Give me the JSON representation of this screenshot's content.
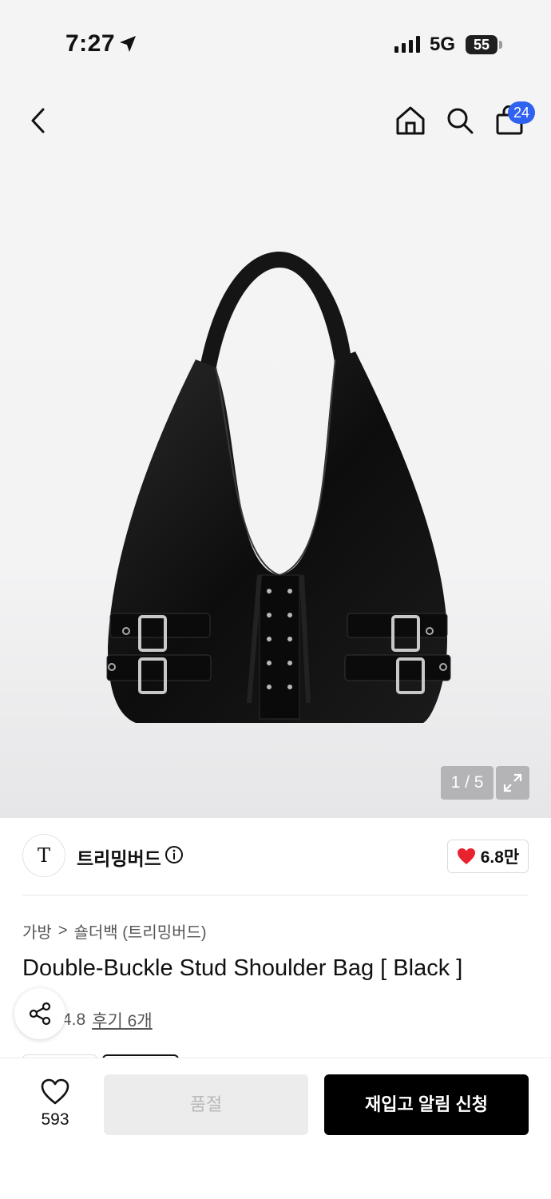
{
  "status_bar": {
    "time": "7:27",
    "network": "5G",
    "battery": "55",
    "location_icon": "location-arrow-icon",
    "signal_icon": "signal-bars-icon"
  },
  "nav": {
    "back_icon": "chevron-left-icon",
    "home_icon": "home-icon",
    "search_icon": "search-icon",
    "cart_icon": "shopping-bag-icon",
    "cart_count": "24"
  },
  "gallery": {
    "counter": "1 / 5",
    "expand_icon": "expand-icon"
  },
  "brand": {
    "logo_text": "T",
    "name": "트리밍버드",
    "info_icon": "info-icon",
    "likes": "6.8만",
    "likes_icon": "heart-filled-icon",
    "accent": "#e8222e"
  },
  "breadcrumb": {
    "category": "가방",
    "separator": ">",
    "subcategory": "숄더백 (트리밍버드)"
  },
  "product": {
    "title": "Double-Buckle Stud Shoulder Bag [ Black ]",
    "rating": "4.8",
    "reviews": "후기 6개"
  },
  "bottom_bar": {
    "wish_icon": "heart-outline-icon",
    "wish_count": "593",
    "soldout_label": "품절",
    "restock_label": "재입고 알림 신청",
    "share_icon": "share-icon"
  },
  "colors": {
    "badge": "#2f62f0",
    "primary_button": "#000000",
    "disabled_button": "#ececec"
  }
}
